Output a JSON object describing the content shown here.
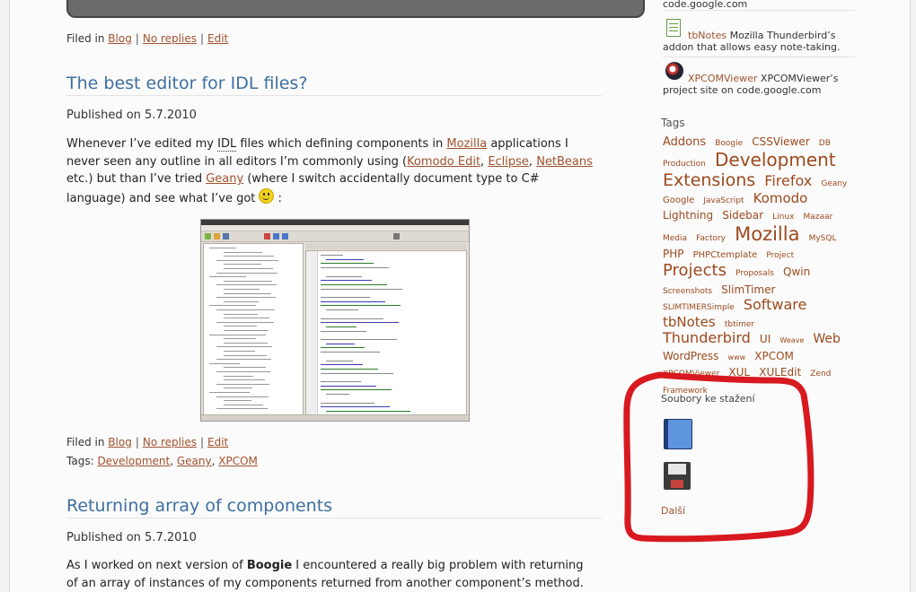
{
  "post_top": {
    "filed_in_label": "Filed in",
    "category": "Blog",
    "replies": "No replies",
    "edit": "Edit"
  },
  "post1": {
    "title": "The best editor for IDL files?",
    "published": "Published on 5.7.2010",
    "p1_a": "Whenever I’ve edited my ",
    "p1_idl": "IDL",
    "p1_b": " files which defining components in ",
    "p1_mozilla": "Mozilla",
    "p1_c": " applications I never seen any outline in all editors I’m commonly using (",
    "p1_komodo": "Komodo Edit",
    "p1_comma1": ", ",
    "p1_eclipse": "Eclipse",
    "p1_comma2": ", ",
    "p1_netbeans": "NetBeans",
    "p1_d": " etc.) but than I’ve tried ",
    "p1_geany": "Geany",
    "p1_e": " (where I switch accidentally document type to C# language) and see what I’ve got",
    "p1_f": " :",
    "filed_in_label": "Filed in",
    "category": "Blog",
    "replies": "No replies",
    "edit": "Edit",
    "tags_label": "Tags:",
    "tags": [
      "Development",
      "Geany",
      "XPCOM"
    ]
  },
  "post2": {
    "title": "Returning array of components",
    "published": "Published on 5.7.2010",
    "p1_a": "As I worked on next version of ",
    "p1_bold": "Boogie",
    "p1_b": " I encountered a really big problem with returning of an array of instances of my components returned from another component’s method."
  },
  "sidebar": {
    "link_fragment_top": "code.google.com",
    "items": [
      {
        "link": "tbNotes",
        "text": " Mozilla Thunderbird’s addon that allows easy note-taking.",
        "icon": "notes-icon"
      },
      {
        "link": "XPCOMViewer",
        "text": " XPCOMViewer’s project site on code.google.com",
        "icon": "xpcom-icon"
      }
    ],
    "tags_heading": "Tags",
    "tags": [
      {
        "t": "Addons",
        "s": 13
      },
      {
        "t": "Boogie",
        "s": 9
      },
      {
        "t": "CSSViewer",
        "s": 12
      },
      {
        "t": "DB",
        "s": 9
      },
      {
        "t": "Production",
        "s": 9
      },
      {
        "t": "Development",
        "s": 20
      },
      {
        "t": "Extensions",
        "s": 19
      },
      {
        "t": "Firefox",
        "s": 16
      },
      {
        "t": "Geany",
        "s": 9
      },
      {
        "t": "Google",
        "s": 10
      },
      {
        "t": "JavaScript",
        "s": 9
      },
      {
        "t": "Komodo",
        "s": 15
      },
      {
        "t": "Lightning",
        "s": 12
      },
      {
        "t": "Sidebar",
        "s": 12
      },
      {
        "t": "Linux",
        "s": 9
      },
      {
        "t": "Mazaar",
        "s": 9
      },
      {
        "t": "Media",
        "s": 9
      },
      {
        "t": "Factory",
        "s": 9
      },
      {
        "t": "Mozilla",
        "s": 21
      },
      {
        "t": "MySQL",
        "s": 9
      },
      {
        "t": "PHP",
        "s": 12
      },
      {
        "t": "PHPCtemplate",
        "s": 10
      },
      {
        "t": "Project",
        "s": 9
      },
      {
        "t": "Projects",
        "s": 18
      },
      {
        "t": "Proposals",
        "s": 9
      },
      {
        "t": "Qwin",
        "s": 12
      },
      {
        "t": "Screenshots",
        "s": 9
      },
      {
        "t": "SlimTimer",
        "s": 12
      },
      {
        "t": "SLIMTIMERSimple",
        "s": 9
      },
      {
        "t": "Software",
        "s": 16
      },
      {
        "t": "tbNotes",
        "s": 15
      },
      {
        "t": "tbtimer",
        "s": 9
      },
      {
        "t": "Thunderbird",
        "s": 16
      },
      {
        "t": "UI",
        "s": 12
      },
      {
        "t": "Weave",
        "s": 8
      },
      {
        "t": "Web",
        "s": 14
      },
      {
        "t": "WordPress",
        "s": 12
      },
      {
        "t": "www",
        "s": 8
      },
      {
        "t": "XPCOM",
        "s": 12
      },
      {
        "t": "XPCOMViewer",
        "s": 9
      },
      {
        "t": "XUL",
        "s": 12
      },
      {
        "t": "XULEdit",
        "s": 12
      },
      {
        "t": "Zend",
        "s": 9
      },
      {
        "t": "Framework",
        "s": 9
      }
    ],
    "downloads_heading": "Soubory ke stažení",
    "downloads": [
      "book-icon",
      "floppy-disk-icon"
    ],
    "more_link": "Další"
  },
  "colors": {
    "link": "#a0522d",
    "title": "#3e6f9e",
    "annotation": "#d8191f"
  }
}
